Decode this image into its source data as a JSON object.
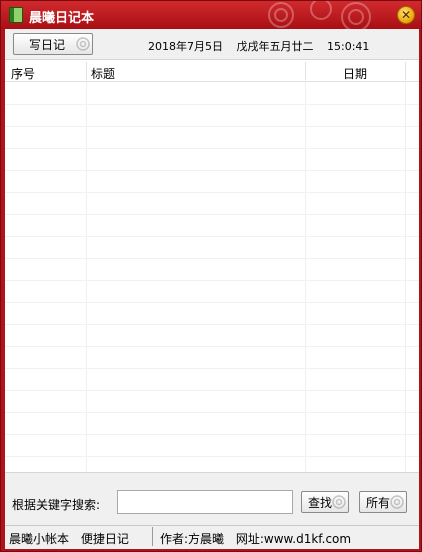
{
  "window": {
    "title": "晨曦日记本"
  },
  "toolbar": {
    "write_label": "写日记",
    "date": "2018年7月5日",
    "lunar": "戊戌年五月廿二",
    "time": "15:0:41"
  },
  "list": {
    "columns": [
      "序号",
      "标题",
      "日期"
    ],
    "rows": []
  },
  "search": {
    "label": "根据关键字搜索:",
    "value": "",
    "find_label": "查找",
    "all_label": "所有"
  },
  "status": {
    "link1": "晨曦小帐本",
    "link2": "便捷日记",
    "author": "作者:方晨曦",
    "site": "网址:www.d1kf.com"
  },
  "colors": {
    "title_bar": "#b0141a",
    "close_button": "#f0b400"
  }
}
